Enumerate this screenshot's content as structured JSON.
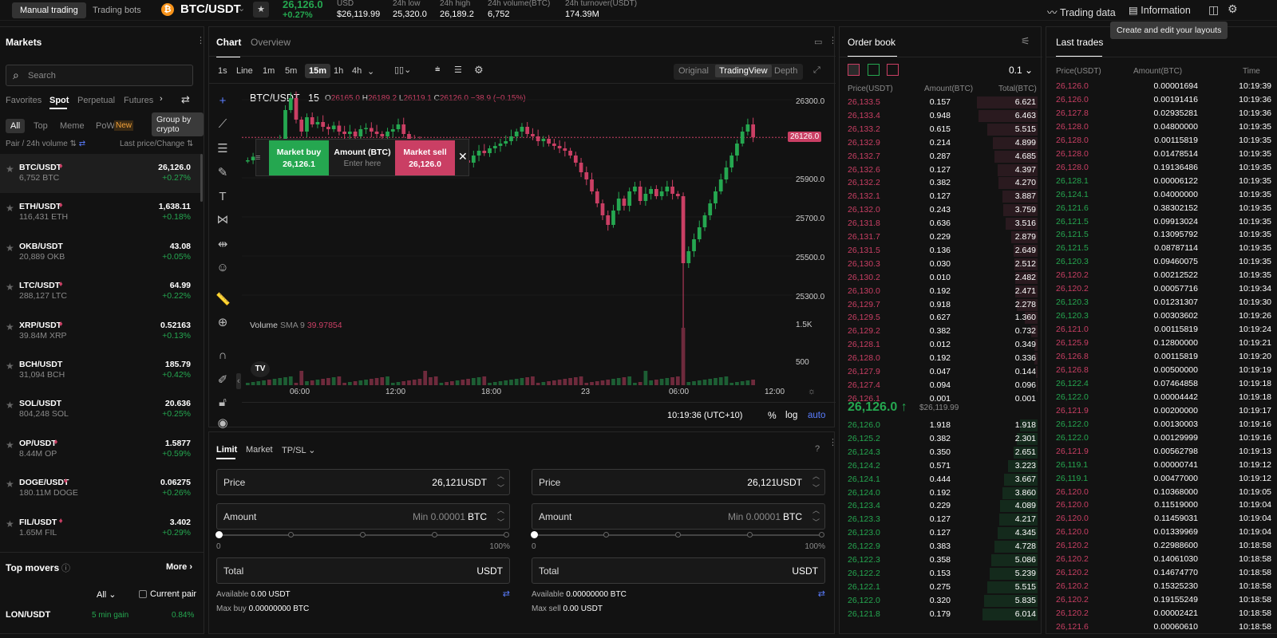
{
  "topbar": {
    "tabs": [
      "Manual trading",
      "Trading bots"
    ],
    "pair": "BTC/USDT",
    "price": "26,126.0",
    "change": "+0.27%",
    "usd_label": "USD",
    "usd_value": "$26,119.99",
    "low_label": "24h low",
    "low_value": "25,320.0",
    "high_label": "24h high",
    "high_value": "26,189.2",
    "vol_label": "24h volume(BTC)",
    "vol_value": "6,752",
    "turn_label": "24h turnover(USDT)",
    "turn_value": "174.39M",
    "trading_data": "Trading data",
    "information": "Information",
    "tooltip": "Create and edit your layouts"
  },
  "markets": {
    "title": "Markets",
    "search_placeholder": "Search",
    "tabs": [
      "Favorites",
      "Spot",
      "Perpetual",
      "Futures"
    ],
    "filters": [
      "All",
      "Top",
      "Meme",
      "PoW"
    ],
    "new_badge": "New",
    "group_tooltip": "Group by crypto",
    "col_pair": "Pair / 24h volume",
    "col_price": "Last price/Change",
    "items": [
      {
        "pair": "BTC/USDT",
        "vol": "6,752 BTC",
        "price": "26,126.0",
        "chg": "+0.27%"
      },
      {
        "pair": "ETH/USDT",
        "vol": "116,431 ETH",
        "price": "1,638.11",
        "chg": "+0.18%"
      },
      {
        "pair": "OKB/USDT",
        "vol": "20,889 OKB",
        "price": "43.08",
        "chg": "+0.05%"
      },
      {
        "pair": "LTC/USDT",
        "vol": "288,127 LTC",
        "price": "64.99",
        "chg": "+0.22%"
      },
      {
        "pair": "XRP/USDT",
        "vol": "39.84M XRP",
        "price": "0.52163",
        "chg": "+0.13%"
      },
      {
        "pair": "BCH/USDT",
        "vol": "31,094 BCH",
        "price": "185.79",
        "chg": "+0.42%"
      },
      {
        "pair": "SOL/USDT",
        "vol": "804,248 SOL",
        "price": "20.636",
        "chg": "+0.25%"
      },
      {
        "pair": "OP/USDT",
        "vol": "8.44M OP",
        "price": "1.5877",
        "chg": "+0.59%"
      },
      {
        "pair": "DOGE/USDT",
        "vol": "180.11M DOGE",
        "price": "0.06275",
        "chg": "+0.26%"
      },
      {
        "pair": "FIL/USDT",
        "vol": "1.65M FIL",
        "price": "3.402",
        "chg": "+0.29%"
      }
    ],
    "top_movers": "Top movers",
    "more": "More",
    "all": "All",
    "current_pair": "Current pair",
    "mover_pair": "LON/USDT",
    "mover_time": "5 min gain",
    "mover_chg": "0.84%"
  },
  "chart": {
    "tabs": [
      "Chart",
      "Overview"
    ],
    "intervals": [
      "1s",
      "Line",
      "1m",
      "5m",
      "15m",
      "1h",
      "4h"
    ],
    "views": [
      "Original",
      "TradingView",
      "Depth"
    ],
    "symbol": "BTC/USDT",
    "interval": "15",
    "o": "26165.0",
    "h": "26189.2",
    "l": "26119.1",
    "c": "26126.0",
    "chg": "−38.9 (−0.15%)",
    "buy_label": "Market buy",
    "buy_price": "26,126.1",
    "amount_label": "Amount (BTC)",
    "amount_ph": "Enter here",
    "sell_label": "Market sell",
    "sell_price": "26,126.0",
    "price_tag": "26126.0",
    "y_ticks": [
      "26300.0",
      "25900.0",
      "25700.0",
      "25500.0",
      "25300.0"
    ],
    "vol_label": "Volume",
    "sma_label": "SMA 9",
    "sma_val": "39.97854",
    "vol_ticks": [
      "1.5K",
      "500"
    ],
    "x_ticks": [
      "06:00",
      "12:00",
      "18:00",
      "23",
      "06:00",
      "12:00"
    ],
    "time": "10:19:36 (UTC+10)",
    "pct": "%",
    "log": "log",
    "auto": "auto",
    "chart_data": {
      "type": "candlestick",
      "series": [
        {
          "values": [
            26030,
            26045,
            26060,
            26080,
            26050,
            26070,
            26120,
            26240,
            26290,
            26200,
            26150,
            26210,
            26180,
            26190,
            26170,
            26160,
            26175,
            26150,
            26140,
            26150,
            26130,
            26160,
            26165,
            26150,
            26140,
            26130,
            26150,
            26160,
            26180,
            26140,
            26120,
            26110,
            26090,
            26060,
            26050,
            26040,
            26060,
            26050,
            26040,
            26050,
            26030,
            26020,
            26050,
            26070,
            26060,
            26080,
            26090,
            26100,
            26110,
            26130,
            26150,
            26170,
            26140,
            26130,
            26110,
            26120,
            26100,
            26090,
            26080,
            26070,
            26050,
            26020,
            25980,
            25950,
            25900,
            25850,
            25800,
            25760,
            25820,
            25870,
            25840,
            25900,
            25920,
            25860,
            25890,
            25910,
            25880,
            25900,
            25920,
            25890,
            25880,
            25600,
            25650,
            25700,
            25750,
            25800,
            25850,
            25900,
            25950,
            26000,
            26050,
            26100,
            26150,
            26180,
            26126
          ]
        }
      ]
    }
  },
  "orderbook": {
    "title": "Order book",
    "step": "0.1",
    "col_price": "Price(USDT)",
    "col_amt": "Amount(BTC)",
    "col_total": "Total(BTC)",
    "asks": [
      [
        "26,133.5",
        "0.157",
        "6.621"
      ],
      [
        "26,133.4",
        "0.948",
        "6.463"
      ],
      [
        "26,133.2",
        "0.615",
        "5.515"
      ],
      [
        "26,132.9",
        "0.214",
        "4.899"
      ],
      [
        "26,132.7",
        "0.287",
        "4.685"
      ],
      [
        "26,132.6",
        "0.127",
        "4.397"
      ],
      [
        "26,132.2",
        "0.382",
        "4.270"
      ],
      [
        "26,132.1",
        "0.127",
        "3.887"
      ],
      [
        "26,132.0",
        "0.243",
        "3.759"
      ],
      [
        "26,131.8",
        "0.636",
        "3.516"
      ],
      [
        "26,131.7",
        "0.229",
        "2.879"
      ],
      [
        "26,131.5",
        "0.136",
        "2.649"
      ],
      [
        "26,130.3",
        "0.030",
        "2.512"
      ],
      [
        "26,130.2",
        "0.010",
        "2.482"
      ],
      [
        "26,130.0",
        "0.192",
        "2.471"
      ],
      [
        "26,129.7",
        "0.918",
        "2.278"
      ],
      [
        "26,129.5",
        "0.627",
        "1.360"
      ],
      [
        "26,129.2",
        "0.382",
        "0.732"
      ],
      [
        "26,128.1",
        "0.012",
        "0.349"
      ],
      [
        "26,128.0",
        "0.192",
        "0.336"
      ],
      [
        "26,127.9",
        "0.047",
        "0.144"
      ],
      [
        "26,127.4",
        "0.094",
        "0.096"
      ],
      [
        "26,126.1",
        "0.001",
        "0.001"
      ]
    ],
    "mid_price": "26,126.0",
    "mid_usd": "$26,119.99",
    "bids": [
      [
        "26,126.0",
        "1.918",
        "1.918"
      ],
      [
        "26,125.2",
        "0.382",
        "2.301"
      ],
      [
        "26,124.3",
        "0.350",
        "2.651"
      ],
      [
        "26,124.2",
        "0.571",
        "3.223"
      ],
      [
        "26,124.1",
        "0.444",
        "3.667"
      ],
      [
        "26,124.0",
        "0.192",
        "3.860"
      ],
      [
        "26,123.4",
        "0.229",
        "4.089"
      ],
      [
        "26,123.3",
        "0.127",
        "4.217"
      ],
      [
        "26,123.0",
        "0.127",
        "4.345"
      ],
      [
        "26,122.9",
        "0.383",
        "4.728"
      ],
      [
        "26,122.3",
        "0.358",
        "5.086"
      ],
      [
        "26,122.2",
        "0.153",
        "5.239"
      ],
      [
        "26,122.1",
        "0.275",
        "5.515"
      ],
      [
        "26,122.0",
        "0.320",
        "5.835"
      ],
      [
        "26,121.8",
        "0.179",
        "6.014"
      ]
    ]
  },
  "trades": {
    "title": "Last trades",
    "col_price": "Price(USDT)",
    "col_amt": "Amount(BTC)",
    "col_time": "Time",
    "rows": [
      [
        "26,126.0",
        "0.00001694",
        "10:19:39",
        "d"
      ],
      [
        "26,126.0",
        "0.00191416",
        "10:19:36",
        "d"
      ],
      [
        "26,127.8",
        "0.02935281",
        "10:19:36",
        "d"
      ],
      [
        "26,128.0",
        "0.04800000",
        "10:19:35",
        "d"
      ],
      [
        "26,128.0",
        "0.00115819",
        "10:19:35",
        "d"
      ],
      [
        "26,128.0",
        "0.01478514",
        "10:19:35",
        "d"
      ],
      [
        "26,128.0",
        "0.19136486",
        "10:19:35",
        "d"
      ],
      [
        "26,128.1",
        "0.00006122",
        "10:19:35",
        "u"
      ],
      [
        "26,124.1",
        "0.04000000",
        "10:19:35",
        "u"
      ],
      [
        "26,121.6",
        "0.38302152",
        "10:19:35",
        "u"
      ],
      [
        "26,121.5",
        "0.09913024",
        "10:19:35",
        "u"
      ],
      [
        "26,121.5",
        "0.13095792",
        "10:19:35",
        "u"
      ],
      [
        "26,121.5",
        "0.08787114",
        "10:19:35",
        "u"
      ],
      [
        "26,120.3",
        "0.09460075",
        "10:19:35",
        "u"
      ],
      [
        "26,120.2",
        "0.00212522",
        "10:19:35",
        "d"
      ],
      [
        "26,120.2",
        "0.00057716",
        "10:19:34",
        "d"
      ],
      [
        "26,120.3",
        "0.01231307",
        "10:19:30",
        "u"
      ],
      [
        "26,120.3",
        "0.00303602",
        "10:19:26",
        "u"
      ],
      [
        "26,121.0",
        "0.00115819",
        "10:19:24",
        "d"
      ],
      [
        "26,125.9",
        "0.12800000",
        "10:19:21",
        "d"
      ],
      [
        "26,126.8",
        "0.00115819",
        "10:19:20",
        "d"
      ],
      [
        "26,126.8",
        "0.00500000",
        "10:19:19",
        "d"
      ],
      [
        "26,122.4",
        "0.07464858",
        "10:19:18",
        "u"
      ],
      [
        "26,122.0",
        "0.00004442",
        "10:19:18",
        "u"
      ],
      [
        "26,121.9",
        "0.00200000",
        "10:19:17",
        "d"
      ],
      [
        "26,122.0",
        "0.00130003",
        "10:19:16",
        "u"
      ],
      [
        "26,122.0",
        "0.00129999",
        "10:19:16",
        "u"
      ],
      [
        "26,121.9",
        "0.00562798",
        "10:19:13",
        "d"
      ],
      [
        "26,119.1",
        "0.00000741",
        "10:19:12",
        "u"
      ],
      [
        "26,119.1",
        "0.00477000",
        "10:19:12",
        "u"
      ],
      [
        "26,120.0",
        "0.10368000",
        "10:19:05",
        "d"
      ],
      [
        "26,120.0",
        "0.11519000",
        "10:19:04",
        "d"
      ],
      [
        "26,120.0",
        "0.11459031",
        "10:19:04",
        "d"
      ],
      [
        "26,120.0",
        "0.01339969",
        "10:19:04",
        "d"
      ],
      [
        "26,120.2",
        "0.22988600",
        "10:18:58",
        "d"
      ],
      [
        "26,120.2",
        "0.14061030",
        "10:18:58",
        "d"
      ],
      [
        "26,120.2",
        "0.14674770",
        "10:18:58",
        "d"
      ],
      [
        "26,120.2",
        "0.15325230",
        "10:18:58",
        "d"
      ],
      [
        "26,120.2",
        "0.19155249",
        "10:18:58",
        "d"
      ],
      [
        "26,120.2",
        "0.00002421",
        "10:18:58",
        "d"
      ],
      [
        "26,121.6",
        "0.00060610",
        "10:18:58",
        "d"
      ]
    ]
  },
  "order": {
    "tabs": [
      "Limit",
      "Market",
      "TP/SL"
    ],
    "price_label": "Price",
    "price_val": "26,121",
    "usdt": "USDT",
    "amount_label": "Amount",
    "amount_ph": "Min 0.00001",
    "btc": "BTC",
    "p0": "0",
    "p100": "100%",
    "total_label": "Total",
    "available_label": "Available",
    "avail_buy": "0.00 USDT",
    "avail_sell": "0.00000000 BTC",
    "maxbuy_label": "Max buy",
    "maxbuy": "0.00000000 BTC",
    "maxsell_label": "Max sell",
    "maxsell": "0.00 USDT"
  }
}
